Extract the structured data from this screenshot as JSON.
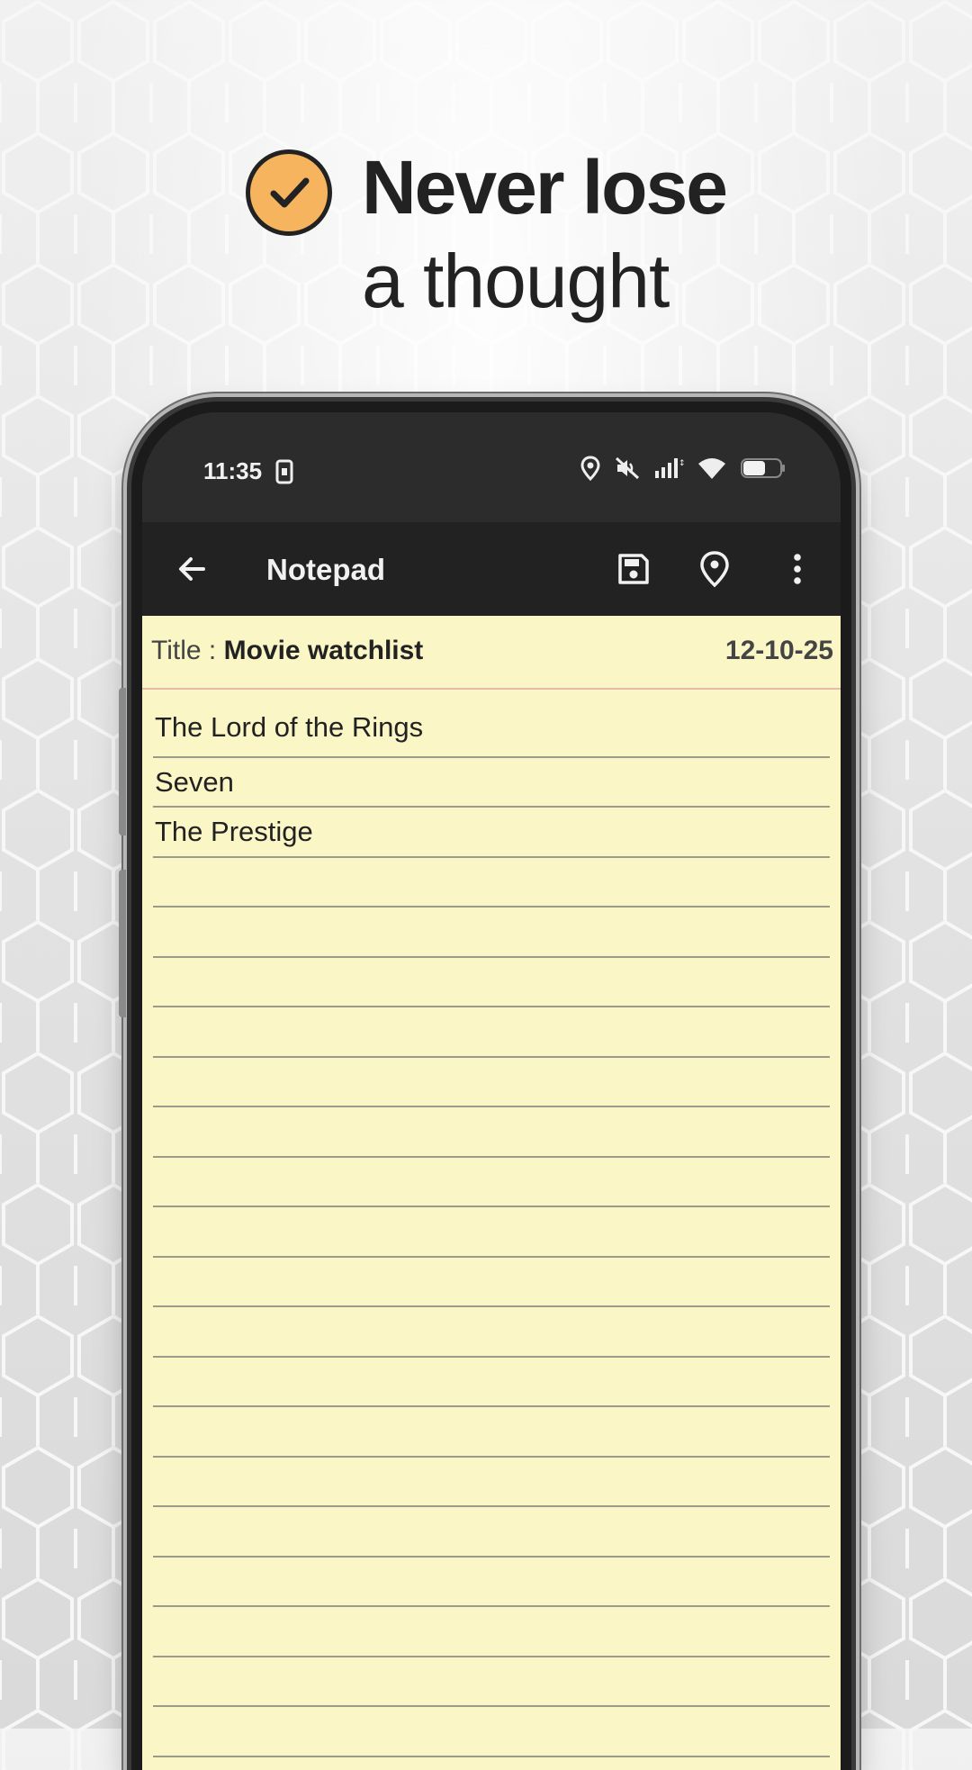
{
  "headline": {
    "bold": "Never lose",
    "light": "a thought",
    "badge_icon": "check-circle-icon",
    "badge_color": "#f7b45e"
  },
  "statusbar": {
    "time": "11:35",
    "icons": [
      "sim-card-icon",
      "location-icon",
      "mute-icon",
      "signal-icon",
      "wifi-icon",
      "battery-icon"
    ]
  },
  "appbar": {
    "title": "Notepad",
    "back_icon": "arrow-left-icon",
    "actions": [
      "save-icon",
      "location-pin-icon",
      "more-vert-icon"
    ]
  },
  "note": {
    "title_label": "Title : ",
    "title": "Movie watchlist",
    "date": "12-10-25",
    "lines": [
      "The Lord of the Rings",
      "Seven",
      "The Prestige"
    ],
    "paper_color": "#fbf6c6"
  }
}
